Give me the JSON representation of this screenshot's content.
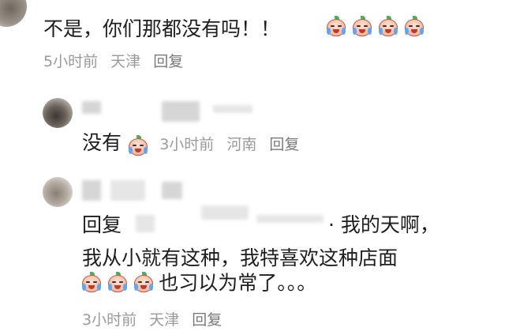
{
  "comment_top": {
    "text": "不是，你们那都没有吗！！",
    "emoji": [
      "crying-face-icon",
      "crying-face-icon",
      "crying-face-icon",
      "crying-face-icon"
    ],
    "time": "5小时前",
    "location": "天津",
    "reply_label": "回复"
  },
  "reply_1": {
    "text": "没有",
    "emoji": "crying-face-icon",
    "time": "3小时前",
    "location": "河南",
    "reply_label": "回复"
  },
  "reply_2": {
    "prefix": "回复",
    "line1_end": "· 我的天啊，",
    "line2": "我从小就有这种，我特喜欢这种店面",
    "line3_text": "也习以为常了。。。",
    "emoji": [
      "crying-face-icon",
      "crying-face-icon",
      "crying-face-icon"
    ],
    "time": "3小时前",
    "location": "天津",
    "reply_label": "回复"
  }
}
